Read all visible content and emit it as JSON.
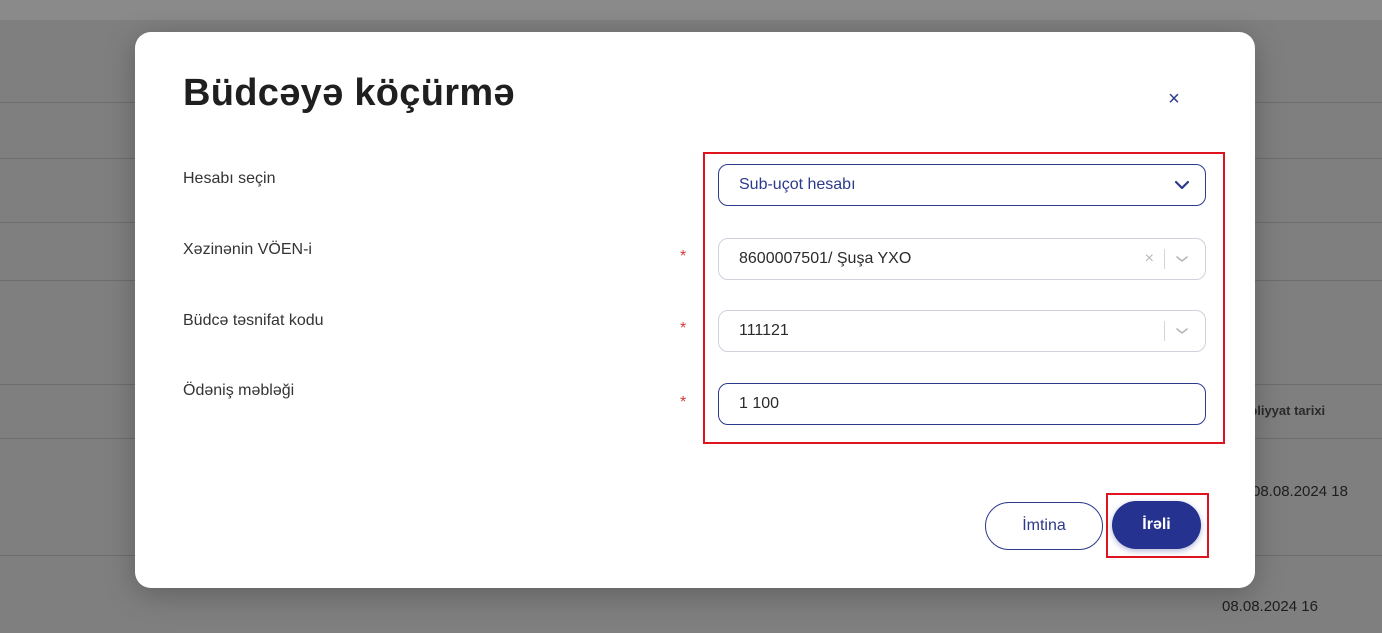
{
  "background": {
    "column_header": "əliyyat tarixi",
    "row_dates": [
      "08.08.2024 18",
      "08.08.2024 16"
    ]
  },
  "modal": {
    "title": "Büdcəyə köçürmə",
    "close_glyph": "×",
    "fields": {
      "account": {
        "label": "Hesabı seçin",
        "value": "Sub-uçot hesabı"
      },
      "treasury_voen": {
        "label": "Xəzinənin VÖEN-i",
        "required_mark": "*",
        "value": "8600007501/ Şuşa YXO",
        "clear_glyph": "×"
      },
      "budget_code": {
        "label": "Büdcə təsnifat kodu",
        "required_mark": "*",
        "value": "111121"
      },
      "amount": {
        "label": "Ödəniş məbləği",
        "required_mark": "*",
        "value": "1 100"
      }
    },
    "buttons": {
      "cancel": "İmtina",
      "next": "İrəli"
    }
  },
  "colors": {
    "accent": "#26328f",
    "highlight": "#e0141e",
    "required": "#d23b3b"
  }
}
